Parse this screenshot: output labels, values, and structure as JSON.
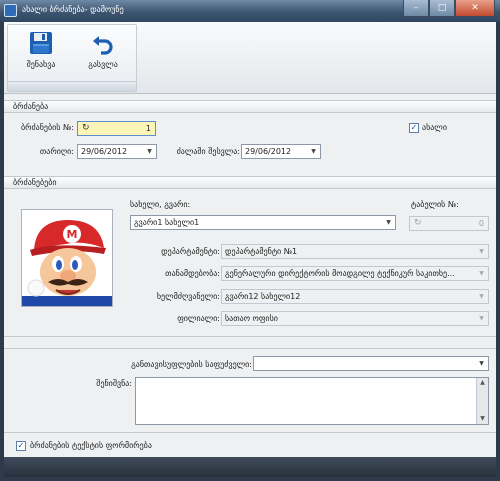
{
  "window": {
    "title": "ახალი ბრძანება- დამოუნე",
    "minimize_glyph": "–",
    "maximize_glyph": "□",
    "close_glyph": "✕"
  },
  "toolbar": {
    "save_label": "შენახვა",
    "exit_label": "გასვლა"
  },
  "order_section": {
    "header": "ბრძანება",
    "number_label": "ბრძანების №:",
    "number_value": "1",
    "new_checkbox_label": "ახალი",
    "new_checked": true,
    "date_label": "თარიღი:",
    "date_value": "29/06/2012",
    "effective_label": "ძალაში შესვლა:",
    "effective_value": "29/06/2012"
  },
  "orders_section": {
    "header": "ბრძანებები",
    "name_label": "სახელი, გვარი:",
    "name_value": "გვარი1 სახელი1",
    "tabel_label": "ტაბელის №:",
    "tabel_value": "0",
    "department_label": "დეპარტამენტი:",
    "department_value": "დეპარტამენტი №1",
    "position_label": "თანამდებობა:",
    "position_value": "გენერალური დირექტორის მოადგილე ტექნიკურ საკითხე...",
    "manager_label": "ხელმძღვანელი:",
    "manager_value": "გვარი12 სახელი12",
    "branch_label": "ფილიალი:",
    "branch_value": "სათაო ოფისი"
  },
  "extra": {
    "dismissal_reason_label": "განთავისუფლების საფუძველი:",
    "dismissal_reason_value": "",
    "note_label": "შენიშვნა:",
    "note_value": "",
    "generate_text_label": "ბრძანების ტექსტის ფორმირება",
    "generate_text_checked": true
  }
}
